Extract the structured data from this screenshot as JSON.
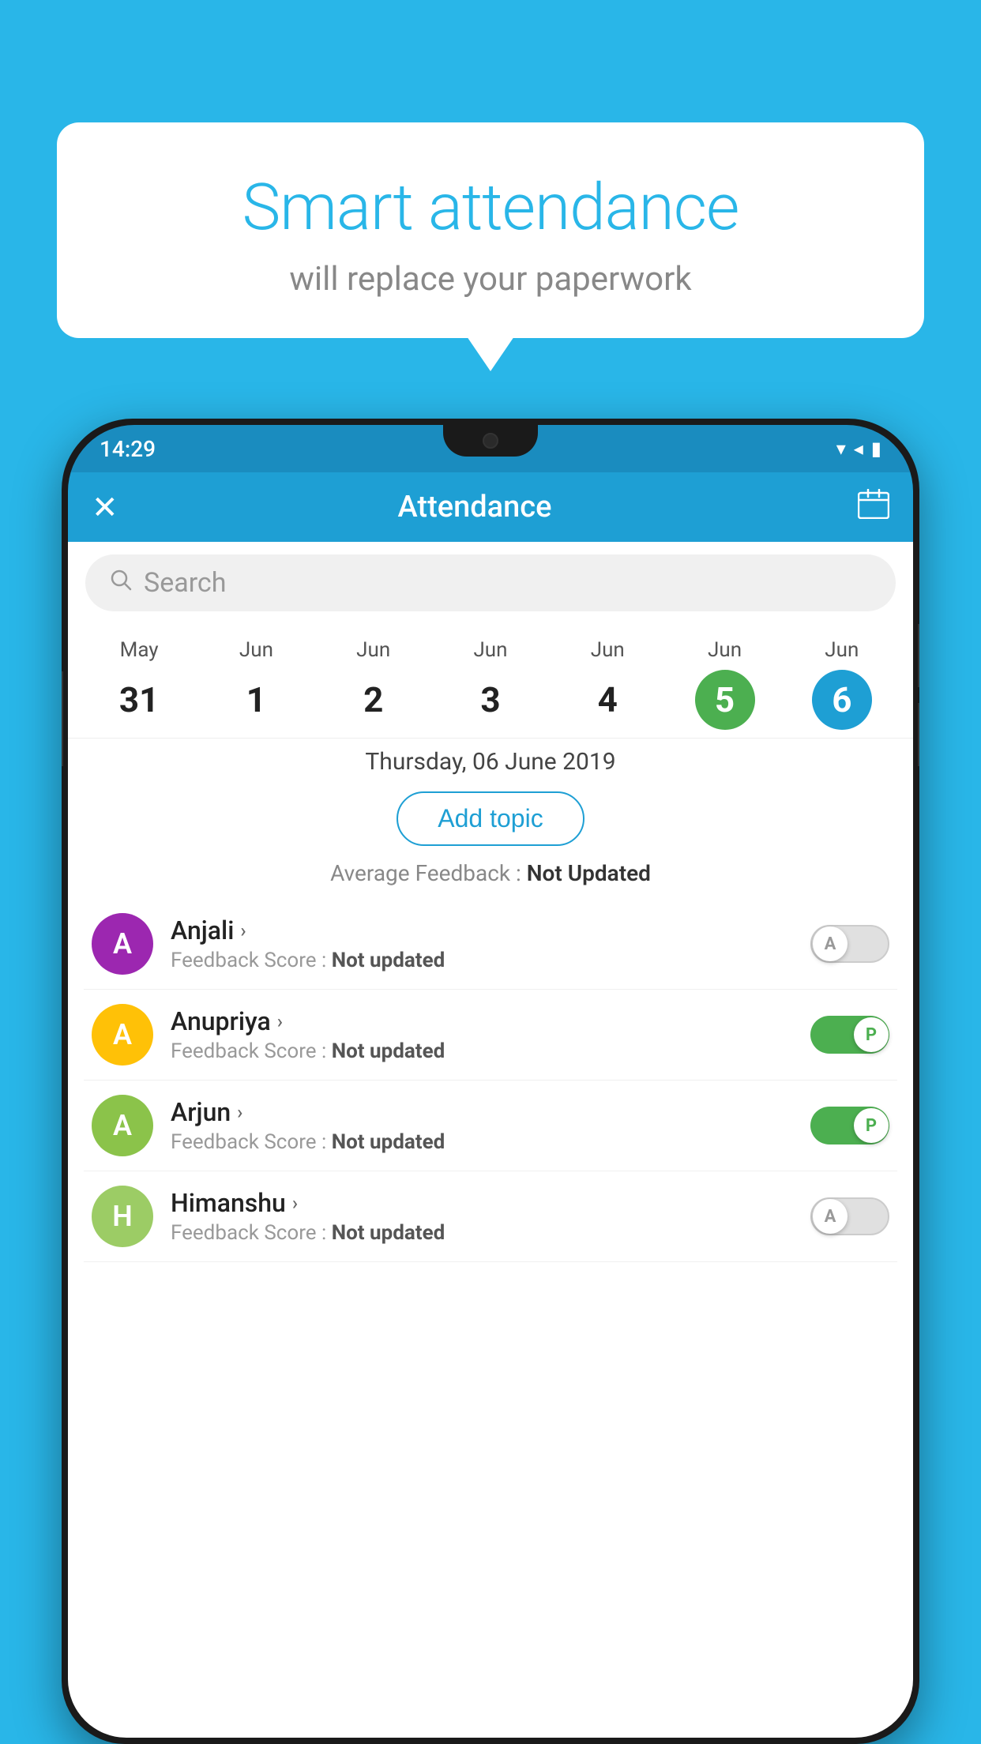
{
  "bubble": {
    "title": "Smart attendance",
    "subtitle": "will replace your paperwork"
  },
  "phone": {
    "status_bar": {
      "time": "14:29",
      "icons": "▾◂▮"
    },
    "app_bar": {
      "close_label": "✕",
      "title": "Attendance",
      "calendar_label": "📅"
    },
    "search": {
      "placeholder": "Search"
    },
    "calendar": {
      "dates": [
        {
          "month": "May",
          "day": "31",
          "style": "normal"
        },
        {
          "month": "Jun",
          "day": "1",
          "style": "normal"
        },
        {
          "month": "Jun",
          "day": "2",
          "style": "normal"
        },
        {
          "month": "Jun",
          "day": "3",
          "style": "normal"
        },
        {
          "month": "Jun",
          "day": "4",
          "style": "normal"
        },
        {
          "month": "Jun",
          "day": "5",
          "style": "green"
        },
        {
          "month": "Jun",
          "day": "6",
          "style": "blue"
        }
      ]
    },
    "date_heading": "Thursday, 06 June 2019",
    "add_topic_label": "Add topic",
    "avg_feedback_label": "Average Feedback :",
    "avg_feedback_value": "Not Updated",
    "students": [
      {
        "name": "Anjali",
        "avatar_letter": "A",
        "avatar_color": "purple",
        "feedback": "Feedback Score :",
        "feedback_value": "Not updated",
        "toggle": "off",
        "toggle_letter": "A"
      },
      {
        "name": "Anupriya",
        "avatar_letter": "A",
        "avatar_color": "yellow",
        "feedback": "Feedback Score :",
        "feedback_value": "Not updated",
        "toggle": "on",
        "toggle_letter": "P"
      },
      {
        "name": "Arjun",
        "avatar_letter": "A",
        "avatar_color": "light-green",
        "feedback": "Feedback Score :",
        "feedback_value": "Not updated",
        "toggle": "on",
        "toggle_letter": "P"
      },
      {
        "name": "Himanshu",
        "avatar_letter": "H",
        "avatar_color": "olive",
        "feedback": "Feedback Score :",
        "feedback_value": "Not updated",
        "toggle": "off",
        "toggle_letter": "A"
      }
    ]
  }
}
